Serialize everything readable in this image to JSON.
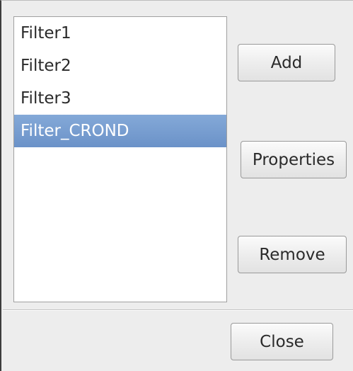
{
  "filter_list": {
    "items": [
      {
        "label": "Filter1",
        "selected": false
      },
      {
        "label": "Filter2",
        "selected": false
      },
      {
        "label": "Filter3",
        "selected": false
      },
      {
        "label": "Filter_CROND",
        "selected": true
      }
    ]
  },
  "buttons": {
    "add_label": "Add",
    "properties_label": "Properties",
    "remove_label": "Remove",
    "close_label": "Close"
  },
  "colors": {
    "selection": "#6b92c8",
    "background": "#ededed"
  }
}
